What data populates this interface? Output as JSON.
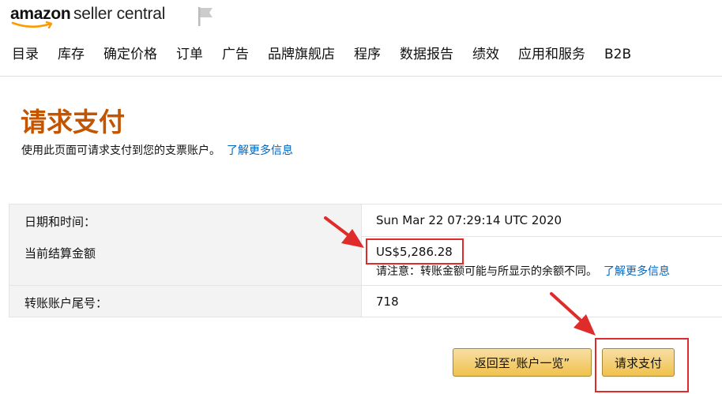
{
  "header": {
    "logo_amazon": "amazon",
    "logo_suffix": "seller central",
    "nav_items": [
      "目录",
      "库存",
      "确定价格",
      "订单",
      "广告",
      "品牌旗舰店",
      "程序",
      "数据报告",
      "绩效",
      "应用和服务",
      "B2B"
    ]
  },
  "page": {
    "title": "请求支付",
    "description": "使用此页面可请求支付到您的支票账户。",
    "learn_more": "了解更多信息"
  },
  "details": {
    "date_label": "日期和时间：",
    "date_value": "Sun Mar 22 07:29:14 UTC 2020",
    "balance_label": "当前结算金额",
    "balance_value": "US$5,286.28",
    "balance_note": "请注意：转账金额可能与所显示的余额不同。",
    "balance_learn_more": "了解更多信息",
    "account_label": "转账账户尾号：",
    "account_value": "718"
  },
  "actions": {
    "back_label": "返回至“账户一览”",
    "request_label": "请求支付"
  },
  "colors": {
    "title": "#c45500",
    "link": "#0066c0",
    "button": "#f0c14b",
    "annotation": "#e02b2b"
  },
  "icons": {
    "logo_smile": "amazon-smile-arrow",
    "flag": "flag-icon"
  }
}
